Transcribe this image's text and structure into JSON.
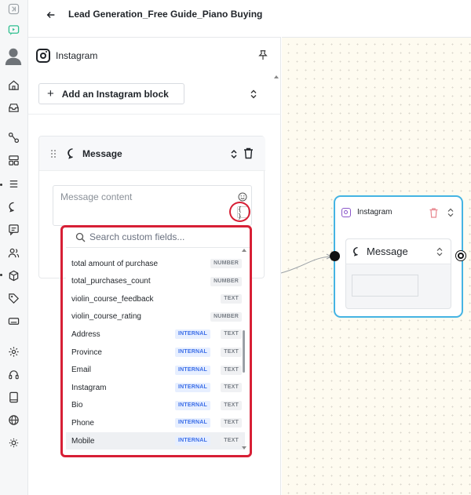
{
  "header": {
    "title": "Lead Generation_Free Guide_Piano Buying"
  },
  "panel": {
    "title": "Instagram",
    "add_block_label": "Add an Instagram block",
    "message_card": {
      "label": "Message",
      "placeholder": "Message content",
      "custom_fields_glyph": "{ }"
    }
  },
  "dropdown": {
    "search_placeholder": "Search custom fields...",
    "items": [
      {
        "name": "total amount of purchase",
        "internal": "",
        "type": "NUMBER"
      },
      {
        "name": "total_purchases_count",
        "internal": "",
        "type": "NUMBER"
      },
      {
        "name": "violin_course_feedback",
        "internal": "",
        "type": "TEXT"
      },
      {
        "name": "violin_course_rating",
        "internal": "",
        "type": "NUMBER"
      },
      {
        "name": "Address",
        "internal": "INTERNAL",
        "type": "TEXT"
      },
      {
        "name": "Province",
        "internal": "INTERNAL",
        "type": "TEXT"
      },
      {
        "name": "Email",
        "internal": "INTERNAL",
        "type": "TEXT"
      },
      {
        "name": "Instagram",
        "internal": "INTERNAL",
        "type": "TEXT"
      },
      {
        "name": "Bio",
        "internal": "INTERNAL",
        "type": "TEXT"
      },
      {
        "name": "Phone",
        "internal": "INTERNAL",
        "type": "TEXT"
      },
      {
        "name": "Mobile",
        "internal": "INTERNAL",
        "type": "TEXT",
        "selected": true
      }
    ]
  },
  "canvas_node": {
    "title": "Instagram",
    "block_label": "Message"
  },
  "colors": {
    "highlight_red": "#d71f35",
    "node_border": "#45b4e3",
    "internal_tag": "#3b6ee8",
    "canvas_bg": "#fefbf0"
  },
  "icons": {
    "rail": [
      "collapse-icon",
      "flow-builder-icon",
      "avatar",
      "home-icon",
      "inbox-icon",
      "flows-icon",
      "templates-icon",
      "list-icon",
      "chat-icon",
      "broadcast-icon",
      "contacts-icon",
      "integrations-icon",
      "tags-icon",
      "keyboard-icon",
      "settings-icon",
      "support-icon",
      "book-icon",
      "globe-icon",
      "theme-icon"
    ]
  }
}
